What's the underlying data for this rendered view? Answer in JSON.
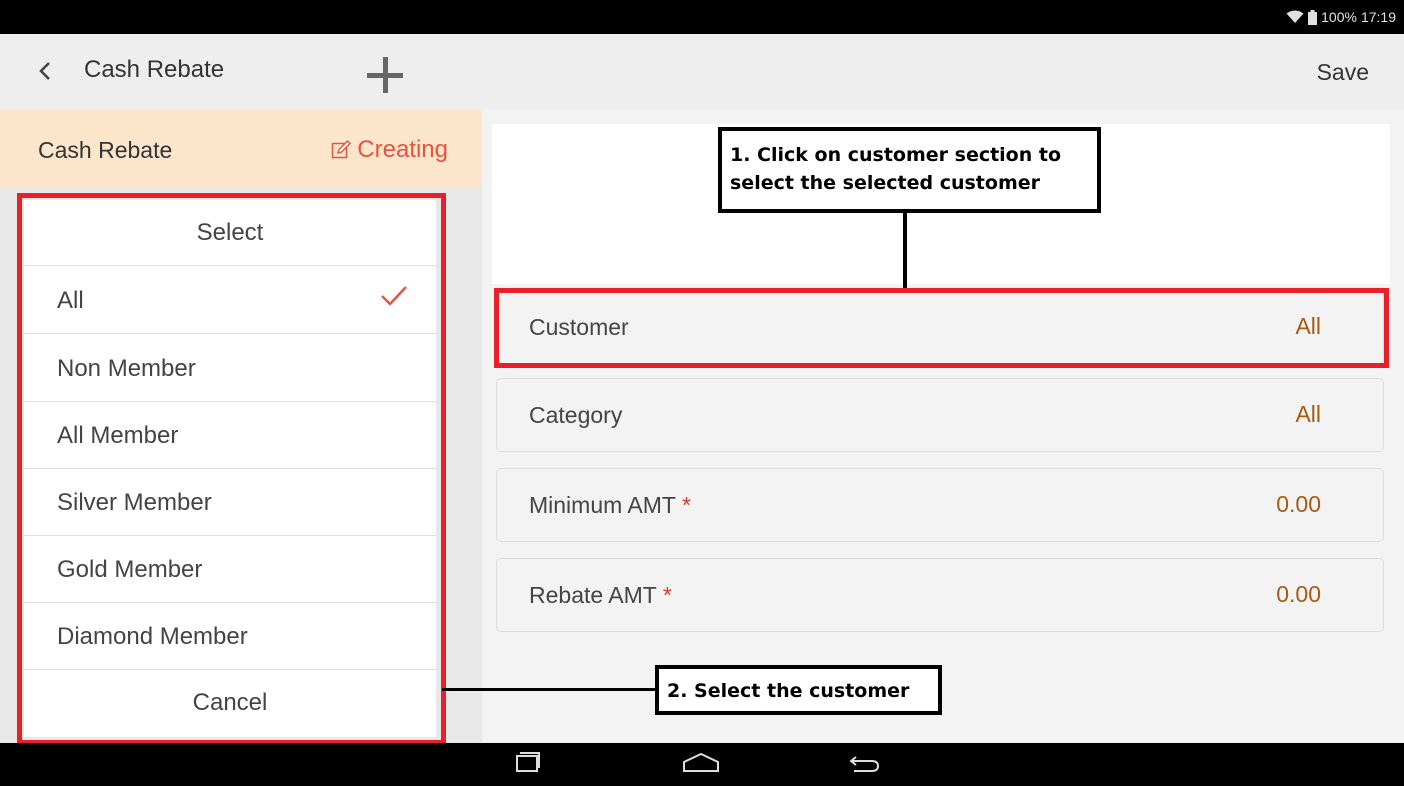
{
  "status_bar": {
    "battery": "100%",
    "time": "17:19"
  },
  "action_bar": {
    "title": "Cash Rebate",
    "save_label": "Save"
  },
  "left_header": {
    "title": "Cash Rebate",
    "status": "Creating"
  },
  "dialog": {
    "title": "Select",
    "options": [
      {
        "label": "All",
        "selected": true
      },
      {
        "label": "Non Member",
        "selected": false
      },
      {
        "label": "All Member",
        "selected": false
      },
      {
        "label": "Silver Member",
        "selected": false
      },
      {
        "label": "Gold Member",
        "selected": false
      },
      {
        "label": "Diamond Member",
        "selected": false
      }
    ],
    "cancel_label": "Cancel"
  },
  "form": {
    "fields": [
      {
        "label": "Customer",
        "value": "All",
        "required": false
      },
      {
        "label": "Category",
        "value": "All",
        "required": false
      },
      {
        "label": "Minimum AMT",
        "value": "0.00",
        "required": true
      },
      {
        "label": "Rebate AMT",
        "value": "0.00",
        "required": true
      }
    ],
    "required_mark": "*"
  },
  "annotations": {
    "step1_line1": "1. Click on customer section to",
    "step1_line2": "select the selected customer",
    "step2": "2. Select the customer"
  },
  "colors": {
    "accent_red": "#e8533d",
    "value_brown": "#a65a12",
    "header_bg": "#fbe6cc",
    "highlight_frame": "#e8202a"
  },
  "icons": [
    "wifi-icon",
    "battery-icon",
    "back-chevron-icon",
    "plus-icon",
    "edit-icon",
    "checkmark-icon",
    "recents-icon",
    "home-icon",
    "back-nav-icon"
  ]
}
